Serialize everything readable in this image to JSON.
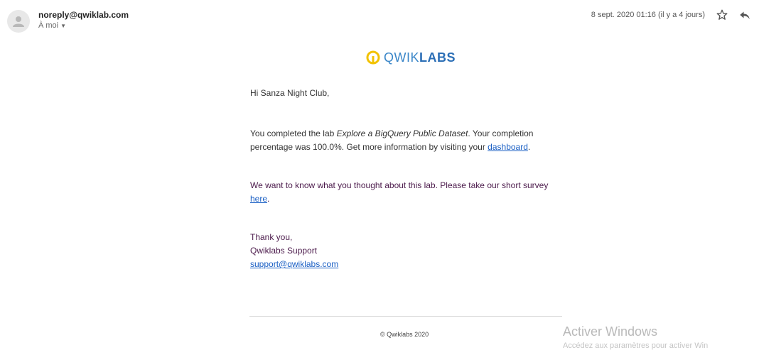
{
  "header": {
    "sender": "noreply@qwiklab.com",
    "recipient": "À moi",
    "date": "8 sept. 2020 01:16 (il y a 4 jours)"
  },
  "logo": {
    "qwik": "QWIK",
    "labs": "LABS",
    "color": "#2c6fb6",
    "ring_color": "#f2c200"
  },
  "body": {
    "greeting": "Hi Sanza Night Club,",
    "para1_prefix": "You completed the lab ",
    "para1_lab": "Explore a BigQuery Public Dataset",
    "para1_mid": ". Your completion percentage was 100.0%. Get more information by visiting your ",
    "para1_link": "dashboard",
    "para1_suffix": ".",
    "para2_prefix": "We want to know what you thought about this lab. Please take our short survey ",
    "para2_link": "here",
    "para2_suffix": ".",
    "thanks": "Thank you,",
    "signature": "Qwiklabs Support",
    "support_email": "support@qwiklabs.com"
  },
  "footer": {
    "copyright": "© Qwiklabs 2020"
  },
  "watermark": {
    "line1": "Activer Windows",
    "line2": "Accédez aux paramètres pour activer Win"
  }
}
